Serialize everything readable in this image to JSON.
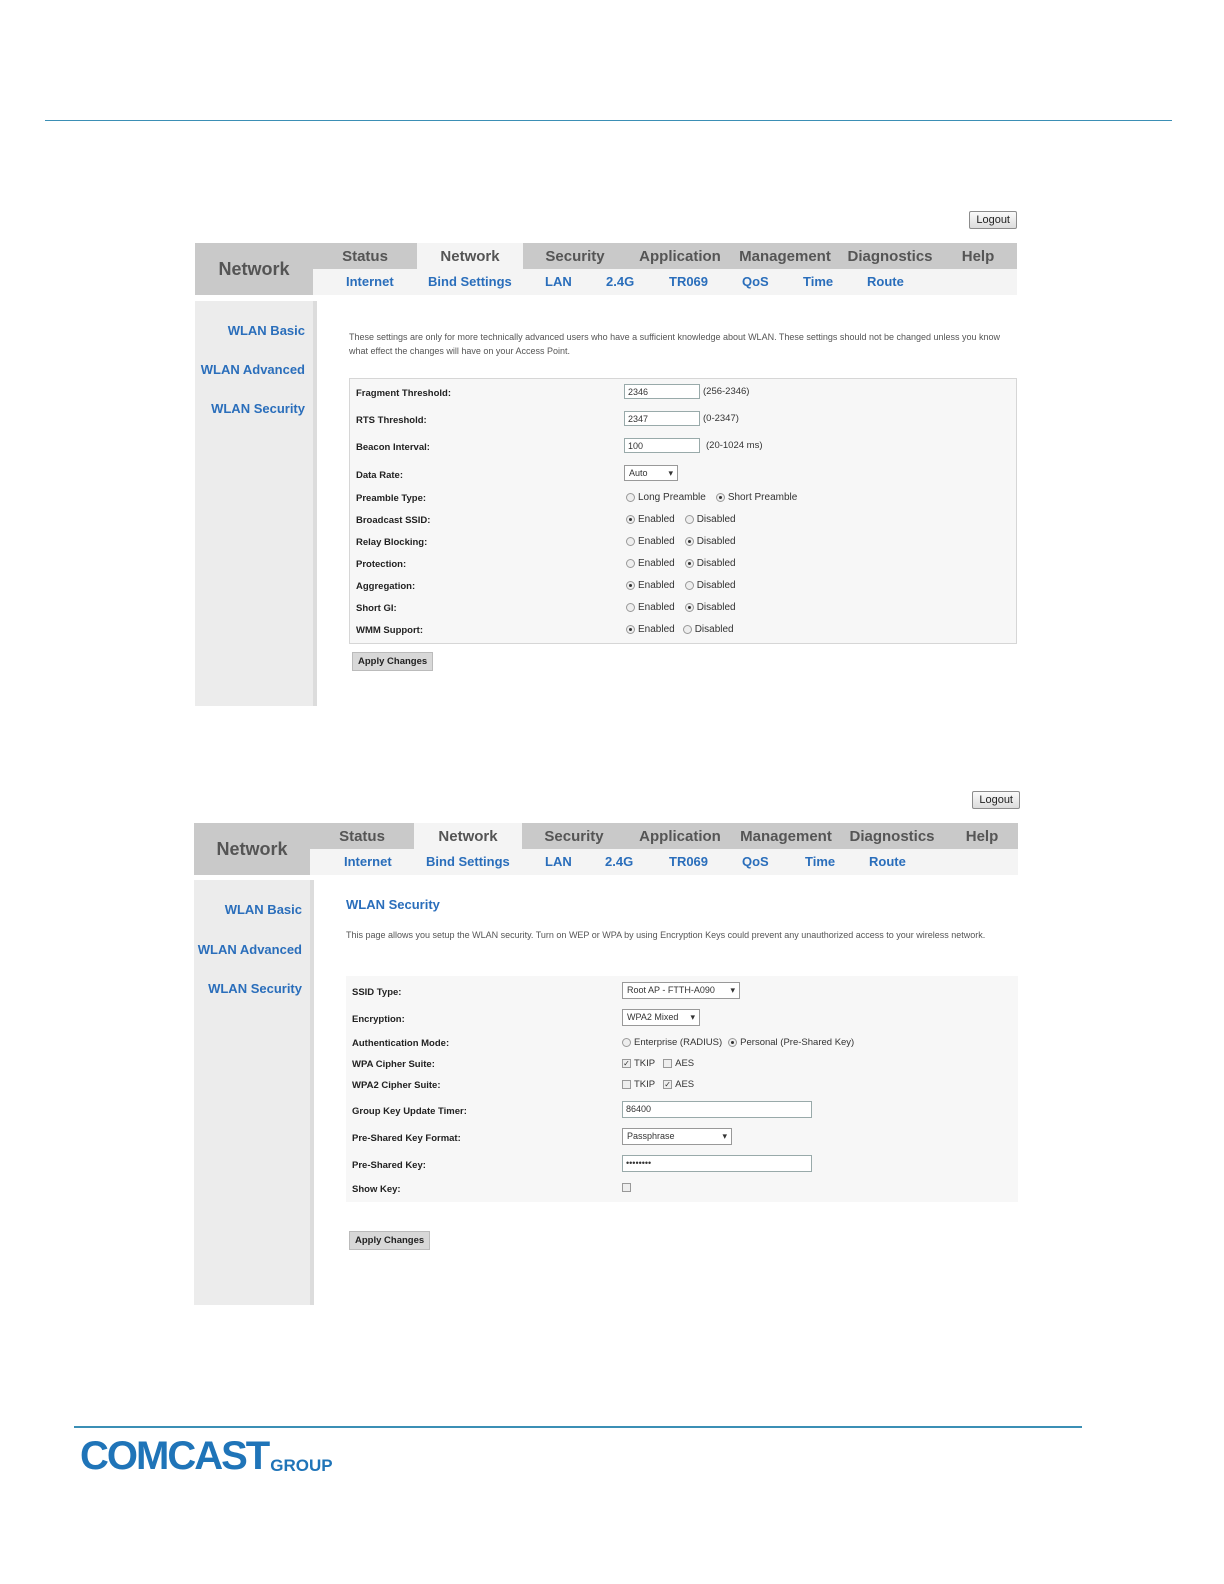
{
  "screens": [
    {
      "logout_label": "Logout",
      "brand": "Network",
      "tabs": [
        "Status",
        "Network",
        "Security",
        "Application",
        "Management",
        "Diagnostics",
        "Help"
      ],
      "active_tab": "Network",
      "subtabs": [
        "Internet",
        "Bind Settings",
        "LAN",
        "2.4G",
        "TR069",
        "QoS",
        "Time",
        "Route"
      ],
      "sidebar": [
        "WLAN Basic",
        "WLAN Advanced",
        "WLAN Security"
      ],
      "description": "These settings are only for more technically advanced users who have a sufficient knowledge about WLAN. These settings should not be changed unless you know what effect the changes will have on your Access Point.",
      "fields": {
        "fragment_threshold": {
          "label": "Fragment Threshold:",
          "value": "2346",
          "hint": "(256-2346)"
        },
        "rts_threshold": {
          "label": "RTS Threshold:",
          "value": "2347",
          "hint": "(0-2347)"
        },
        "beacon_interval": {
          "label": "Beacon Interval:",
          "value": "100",
          "hint": "(20-1024 ms)"
        },
        "data_rate": {
          "label": "Data Rate:",
          "value": "Auto"
        },
        "preamble_type": {
          "label": "Preamble Type:",
          "options": [
            "Long Preamble",
            "Short Preamble"
          ],
          "selected": "Short Preamble"
        },
        "broadcast_ssid": {
          "label": "Broadcast SSID:",
          "options": [
            "Enabled",
            "Disabled"
          ],
          "selected": "Enabled"
        },
        "relay_blocking": {
          "label": "Relay Blocking:",
          "options": [
            "Enabled",
            "Disabled"
          ],
          "selected": "Disabled"
        },
        "protection": {
          "label": "Protection:",
          "options": [
            "Enabled",
            "Disabled"
          ],
          "selected": "Disabled"
        },
        "aggregation": {
          "label": "Aggregation:",
          "options": [
            "Enabled",
            "Disabled"
          ],
          "selected": "Enabled"
        },
        "short_gi": {
          "label": "Short GI:",
          "options": [
            "Enabled",
            "Disabled"
          ],
          "selected": "Disabled"
        },
        "wmm_support": {
          "label": "WMM Support:",
          "options": [
            "Enabled",
            "Disabled"
          ],
          "selected": "Enabled"
        }
      },
      "apply_label": "Apply Changes"
    },
    {
      "logout_label": "Logout",
      "brand": "Network",
      "tabs": [
        "Status",
        "Network",
        "Security",
        "Application",
        "Management",
        "Diagnostics",
        "Help"
      ],
      "active_tab": "Network",
      "subtabs": [
        "Internet",
        "Bind Settings",
        "LAN",
        "2.4G",
        "TR069",
        "QoS",
        "Time",
        "Route"
      ],
      "sidebar": [
        "WLAN Basic",
        "WLAN Advanced",
        "WLAN Security"
      ],
      "page_title": "WLAN Security",
      "description": "This page allows you setup the WLAN security. Turn on WEP or WPA by using Encryption Keys could prevent any unauthorized access to your wireless network.",
      "fields": {
        "ssid_type": {
          "label": "SSID Type:",
          "value": "Root AP - FTTH-A090"
        },
        "encryption": {
          "label": "Encryption:",
          "value": "WPA2 Mixed"
        },
        "auth_mode": {
          "label": "Authentication Mode:",
          "options": [
            "Enterprise (RADIUS)",
            "Personal (Pre-Shared Key)"
          ],
          "selected": "Personal (Pre-Shared Key)"
        },
        "wpa_cipher": {
          "label": "WPA Cipher Suite:",
          "options": [
            "TKIP",
            "AES"
          ],
          "checked": [
            "TKIP"
          ]
        },
        "wpa2_cipher": {
          "label": "WPA2 Cipher Suite:",
          "options": [
            "TKIP",
            "AES"
          ],
          "checked": [
            "AES"
          ]
        },
        "group_key_timer": {
          "label": "Group Key Update Timer:",
          "value": "86400"
        },
        "psk_format": {
          "label": "Pre-Shared Key Format:",
          "value": "Passphrase"
        },
        "psk": {
          "label": "Pre-Shared Key:",
          "value": "••••••••"
        },
        "show_key": {
          "label": "Show Key:",
          "checked": false
        }
      },
      "apply_label": "Apply Changes"
    }
  ],
  "footer": {
    "logo_main": "COMCAST",
    "logo_sub": "GROUP"
  },
  "colors": {
    "link": "#2a6ebb",
    "rule": "#3b8fb5",
    "logo": "#1f74b8"
  }
}
